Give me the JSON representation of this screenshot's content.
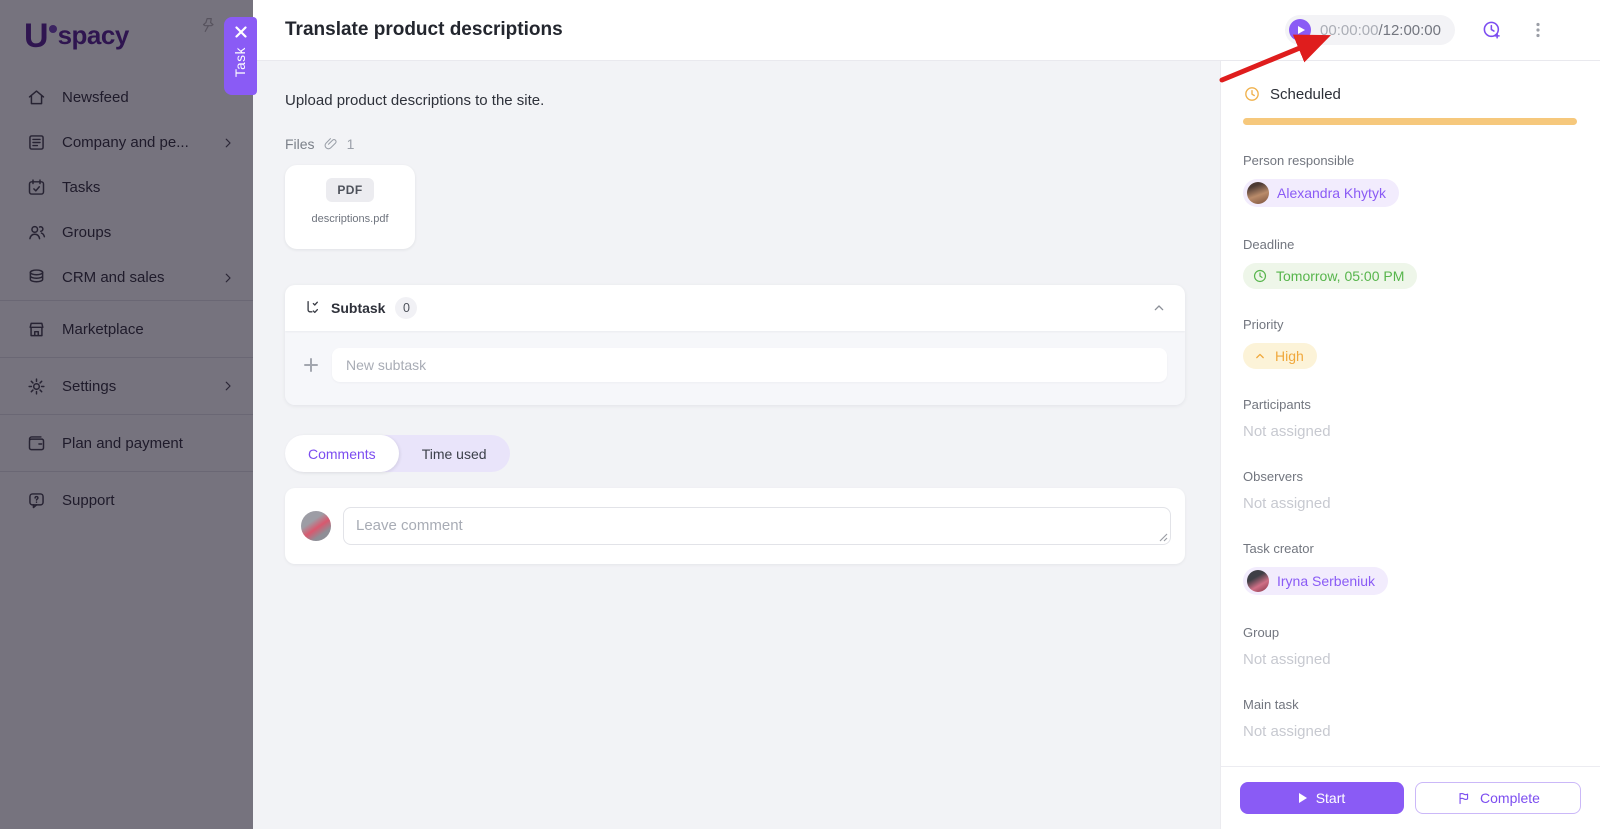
{
  "app": {
    "logo_u": "U",
    "logo_rest": "spacy"
  },
  "panel_tab": {
    "label": "Task"
  },
  "sidebar": {
    "items": [
      {
        "label": "Newsfeed",
        "icon": "home-icon",
        "chevron": false
      },
      {
        "label": "Company and pe...",
        "icon": "company-icon",
        "chevron": true
      },
      {
        "label": "Tasks",
        "icon": "calendar-check-icon",
        "chevron": false
      },
      {
        "label": "Groups",
        "icon": "people-icon",
        "chevron": false
      },
      {
        "label": "CRM and sales",
        "icon": "database-icon",
        "chevron": true
      },
      {
        "label": "Marketplace",
        "icon": "storefront-icon",
        "chevron": false
      },
      {
        "label": "Settings",
        "icon": "gear-icon",
        "chevron": true
      },
      {
        "label": "Plan and payment",
        "icon": "wallet-icon",
        "chevron": false
      },
      {
        "label": "Support",
        "icon": "help-bubble-icon",
        "chevron": false
      }
    ]
  },
  "header": {
    "title": "Translate product descriptions",
    "timer": {
      "elapsed": "00:00:00",
      "planned": "/12:00:00"
    }
  },
  "main": {
    "description": "Upload product descriptions to the site.",
    "files": {
      "label": "Files",
      "count": "1",
      "file": {
        "type": "PDF",
        "name": "descriptions.pdf"
      }
    },
    "subtask": {
      "title": "Subtask",
      "count": "0",
      "input_placeholder": "New subtask"
    },
    "tabs": [
      {
        "label": "Comments",
        "active": true
      },
      {
        "label": "Time used",
        "active": false
      }
    ],
    "comment_placeholder": "Leave comment"
  },
  "details": {
    "status": {
      "label": "Scheduled"
    },
    "fields": [
      {
        "label": "Person responsible",
        "type": "person",
        "value": "Alexandra Khytyk"
      },
      {
        "label": "Deadline",
        "type": "deadline",
        "value": "Tomorrow, 05:00 PM"
      },
      {
        "label": "Priority",
        "type": "priority",
        "value": "High"
      },
      {
        "label": "Participants",
        "type": "empty",
        "value": "Not assigned"
      },
      {
        "label": "Observers",
        "type": "empty",
        "value": "Not assigned"
      },
      {
        "label": "Task creator",
        "type": "person",
        "value": "Iryna Serbeniuk"
      },
      {
        "label": "Group",
        "type": "empty",
        "value": "Not assigned"
      },
      {
        "label": "Main task",
        "type": "empty",
        "value": "Not assigned"
      }
    ],
    "buttons": {
      "start": "Start",
      "complete": "Complete"
    }
  },
  "colors": {
    "accent_purple": "#8a5bf5",
    "status_amber": "#f6c87c",
    "deadline_green": "#57b54c",
    "priority_orange": "#f0a83c",
    "annotation_red": "#df1d1d",
    "dim_overlay": "rgba(10,5,25,0.56)"
  }
}
